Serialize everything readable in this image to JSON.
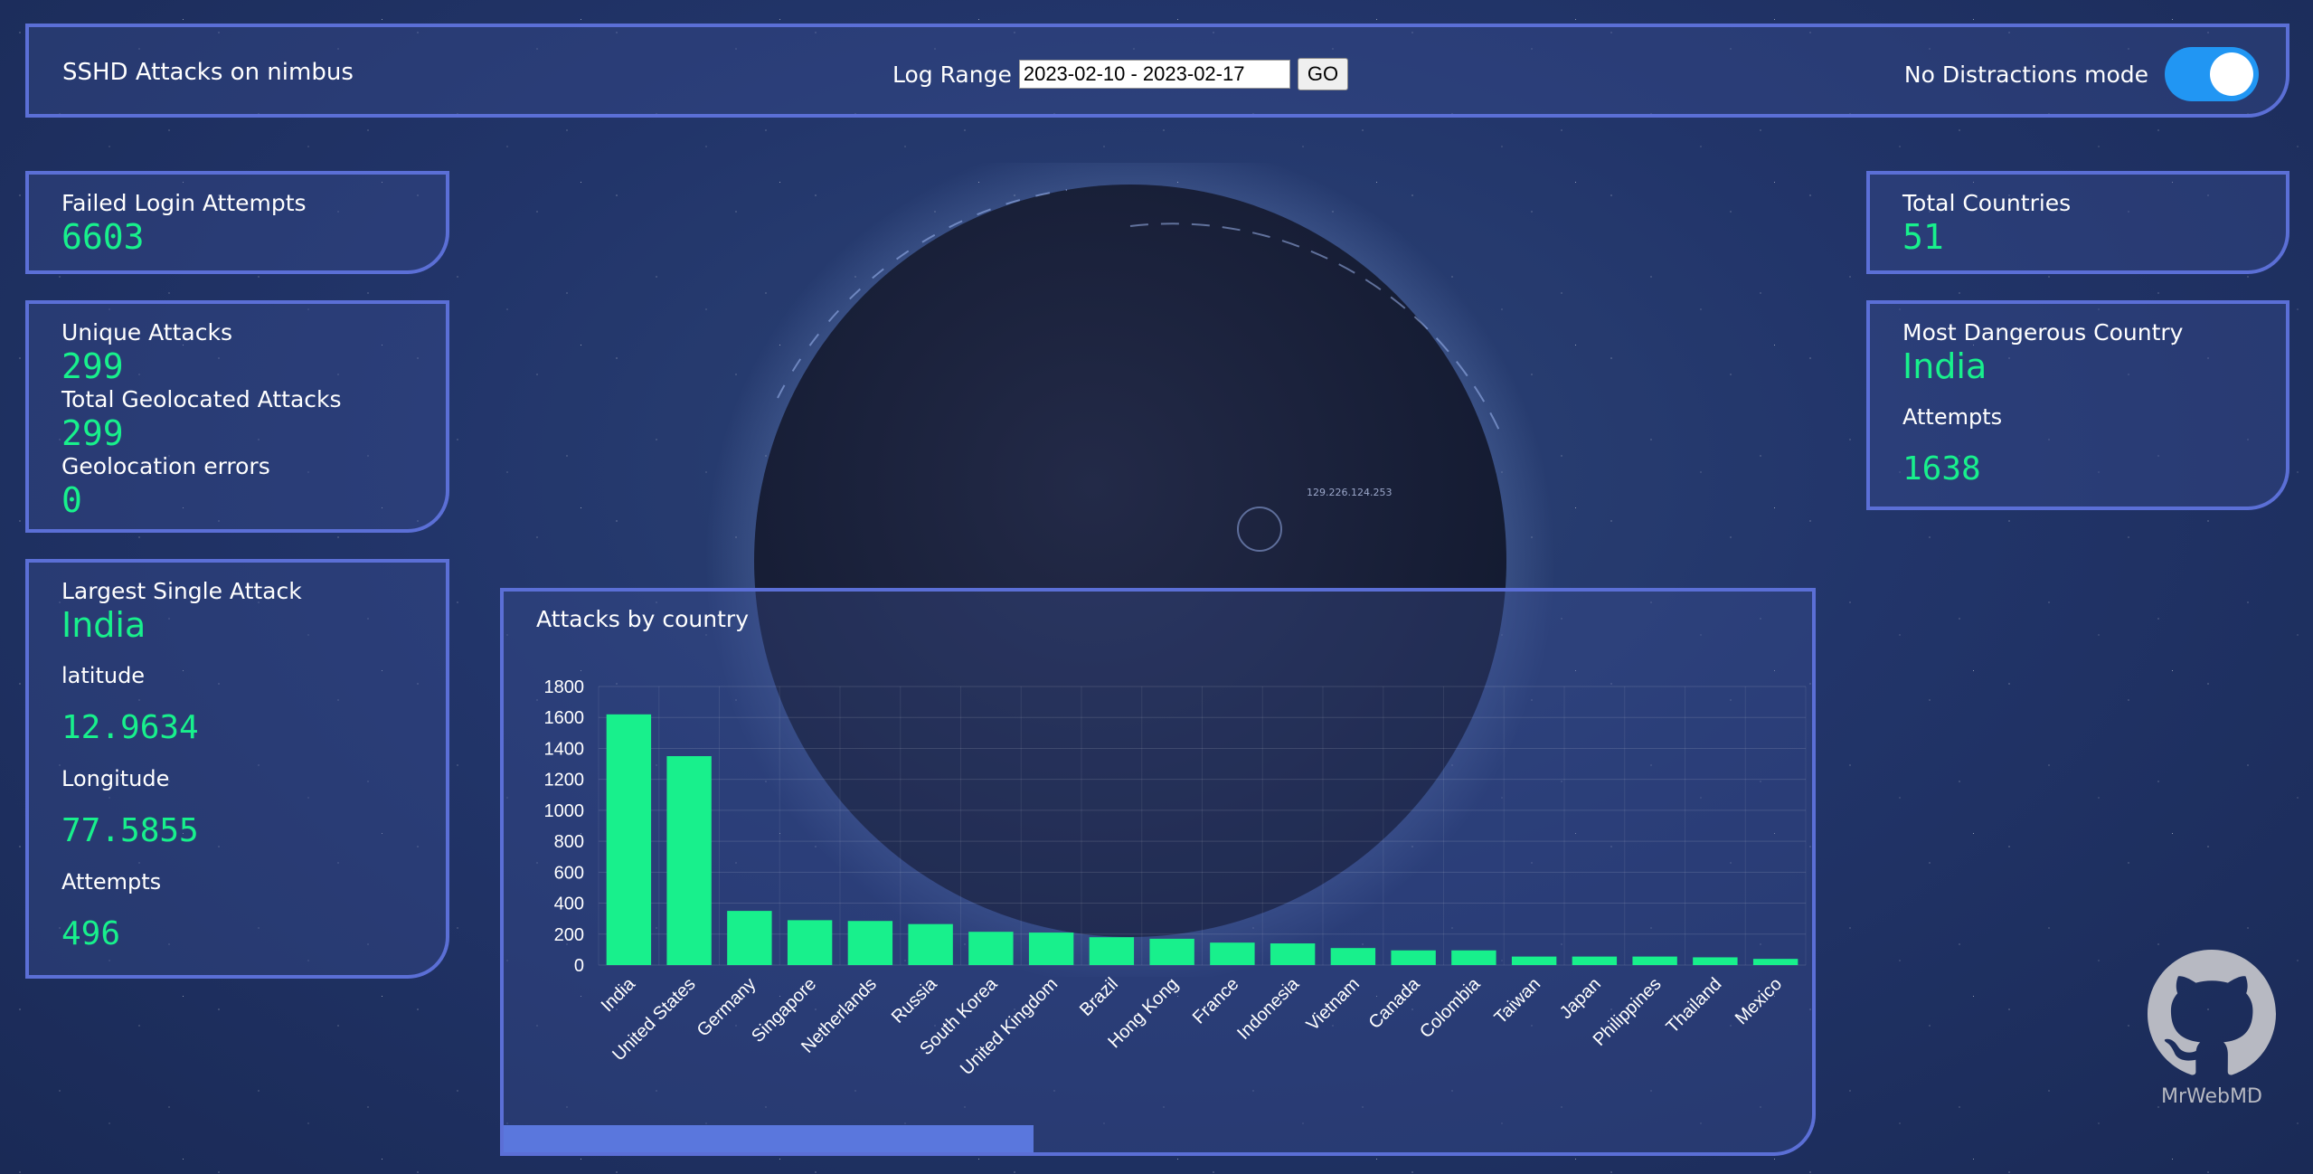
{
  "header": {
    "title": "SSHD Attacks on nimbus",
    "log_range_label": "Log Range",
    "log_range_value": "2023-02-10 - 2023-02-17",
    "go_label": "GO",
    "no_distractions_label": "No Distractions mode",
    "no_distractions_on": true
  },
  "failed_login": {
    "label": "Failed Login Attempts",
    "value": "6603"
  },
  "attacks": {
    "unique_label": "Unique Attacks",
    "unique_value": "299",
    "geolocated_label": "Total Geolocated Attacks",
    "geolocated_value": "299",
    "errors_label": "Geolocation errors",
    "errors_value": "0"
  },
  "largest": {
    "label": "Largest Single Attack",
    "country": "India",
    "lat_label": "latitude",
    "lat_value": "12.9634",
    "lon_label": "Longitude",
    "lon_value": "77.5855",
    "attempts_label": "Attempts",
    "attempts_value": "496"
  },
  "total_countries": {
    "label": "Total Countries",
    "value": "51"
  },
  "dangerous": {
    "label": "Most Dangerous Country",
    "country": "India",
    "attempts_label": "Attempts",
    "attempts_value": "1638"
  },
  "globe": {
    "ip_label": "129.226.124.253"
  },
  "chart_title": "Attacks by country",
  "chart_data": {
    "type": "bar",
    "title": "Attacks by country",
    "categories": [
      "India",
      "United States",
      "Germany",
      "Singapore",
      "Netherlands",
      "Russia",
      "South Korea",
      "United Kingdom",
      "Brazil",
      "Hong Kong",
      "France",
      "Indonesia",
      "Vietnam",
      "Canada",
      "Colombia",
      "Taiwan",
      "Japan",
      "Philippines",
      "Thailand",
      "Mexico"
    ],
    "values": [
      1620,
      1350,
      350,
      290,
      285,
      265,
      215,
      210,
      180,
      170,
      145,
      140,
      110,
      95,
      95,
      55,
      55,
      55,
      50,
      40
    ],
    "yticks": [
      0,
      200,
      400,
      600,
      800,
      1000,
      1200,
      1400,
      1600,
      1800
    ],
    "ylim": [
      0,
      1800
    ],
    "grid": true,
    "bar_color": "#18f08c"
  },
  "footer": {
    "github_label": "MrWebMD"
  }
}
